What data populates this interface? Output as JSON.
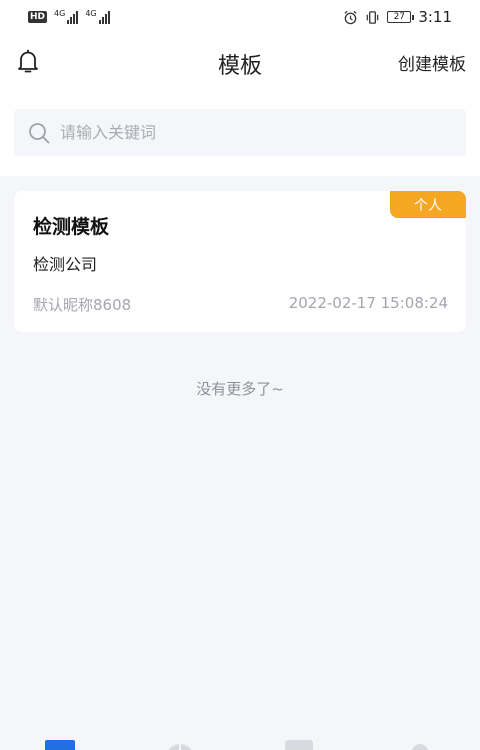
{
  "status_bar": {
    "hd": "HD",
    "signal1": "4G",
    "signal2": "4G",
    "battery": "27",
    "time": "3:11"
  },
  "header": {
    "title": "模板",
    "create_label": "创建模板"
  },
  "search": {
    "placeholder": "请输入关键词"
  },
  "templates": [
    {
      "tag": "个人",
      "title": "检测模板",
      "company": "检测公司",
      "user": "默认昵称8608",
      "time": "2022-02-17 15:08:24"
    }
  ],
  "list_end_text": "没有更多了~",
  "colors": {
    "accent": "#1f6fe5",
    "tag": "#f5a623",
    "background": "#f5f6fa"
  },
  "tabbar": {
    "icons": [
      "home-icon",
      "chart-icon",
      "document-icon",
      "profile-icon"
    ]
  }
}
